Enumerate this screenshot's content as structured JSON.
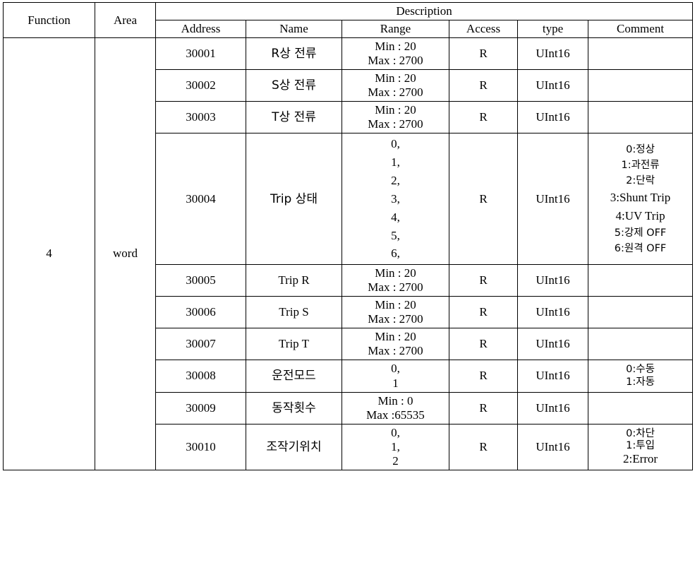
{
  "table": {
    "top_headers": {
      "function": "Function",
      "area": "Area",
      "description": "Description"
    },
    "sub_headers": {
      "address": "Address",
      "name": "Name",
      "range": "Range",
      "access": "Access",
      "type": "type",
      "comment": "Comment"
    },
    "function_value": "4",
    "area_value": "word",
    "rows": [
      {
        "address": "30001",
        "name": "R상 전류",
        "range": [
          "Min : 20",
          "Max : 2700"
        ],
        "access": "R",
        "type": "UInt16",
        "comment": []
      },
      {
        "address": "30002",
        "name": "S상 전류",
        "range": [
          "Min : 20",
          "Max : 2700"
        ],
        "access": "R",
        "type": "UInt16",
        "comment": []
      },
      {
        "address": "30003",
        "name": "T상 전류",
        "range": [
          "Min : 20",
          "Max : 2700"
        ],
        "access": "R",
        "type": "UInt16",
        "comment": []
      },
      {
        "address": "30004",
        "name": "Trip 상태",
        "range": [
          "0,",
          "1,",
          "2,",
          "3,",
          "4,",
          "5,",
          "6,"
        ],
        "access": "R",
        "type": "UInt16",
        "comment": [
          "0:정상",
          "1:과전류",
          "2:단락",
          "3:Shunt Trip",
          "4:UV Trip",
          "5:강제 OFF",
          "6:원격 OFF"
        ]
      },
      {
        "address": "30005",
        "name": "Trip R",
        "range": [
          "Min : 20",
          "Max : 2700"
        ],
        "access": "R",
        "type": "UInt16",
        "comment": []
      },
      {
        "address": "30006",
        "name": "Trip S",
        "range": [
          "Min : 20",
          "Max : 2700"
        ],
        "access": "R",
        "type": "UInt16",
        "comment": []
      },
      {
        "address": "30007",
        "name": "Trip T",
        "range": [
          "Min : 20",
          "Max : 2700"
        ],
        "access": "R",
        "type": "UInt16",
        "comment": []
      },
      {
        "address": "30008",
        "name": "운전모드",
        "range": [
          "0,",
          "1"
        ],
        "access": "R",
        "type": "UInt16",
        "comment": [
          "0:수동",
          "1:자동"
        ]
      },
      {
        "address": "30009",
        "name": "동작횟수",
        "range": [
          "Min : 0",
          "Max :65535"
        ],
        "access": "R",
        "type": "UInt16",
        "comment": []
      },
      {
        "address": "30010",
        "name": "조작기위치",
        "range": [
          "0,",
          "1,",
          "2"
        ],
        "access": "R",
        "type": "UInt16",
        "comment": [
          "0:차단",
          "1:투입",
          "2:Error"
        ]
      }
    ]
  }
}
